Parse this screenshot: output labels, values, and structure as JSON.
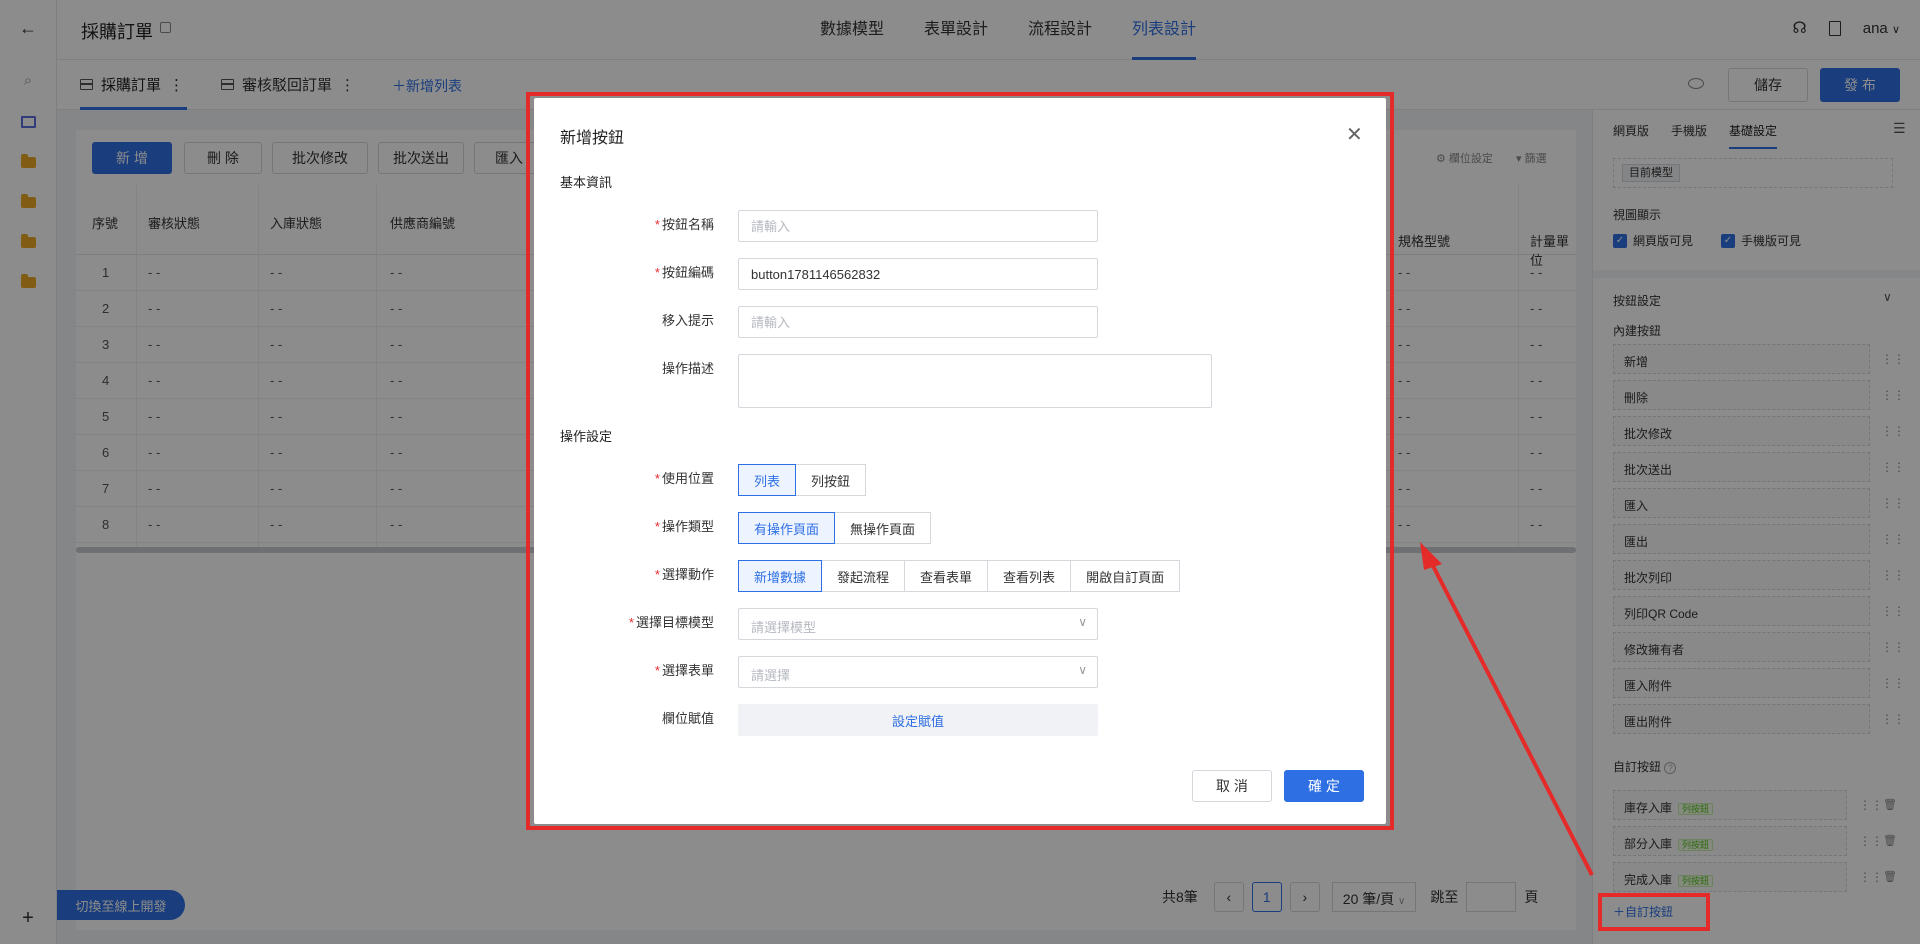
{
  "header": {
    "app_title": "採購訂單",
    "nav_tabs": [
      "數據模型",
      "表單設計",
      "流程設計",
      "列表設計"
    ],
    "user": "ana"
  },
  "subheader": {
    "list_tabs": [
      "採購訂單",
      "審核駁回訂單"
    ],
    "add_list": "＋新增列表",
    "save": "儲存",
    "publish": "發 布"
  },
  "toolbar": {
    "buttons": [
      "新 增",
      "刪 除",
      "批次修改",
      "批次送出",
      "匯入"
    ],
    "column_settings": "欄位設定",
    "filter": "篩選"
  },
  "table": {
    "headers": [
      "序號",
      "審核狀態",
      "入庫狀態",
      "供應商編號",
      "規格型號",
      "計量單位"
    ],
    "rows": [
      [
        "1",
        "- -",
        "- -",
        "- -",
        "- -",
        "- -"
      ],
      [
        "2",
        "- -",
        "- -",
        "- -",
        "- -",
        "- -"
      ],
      [
        "3",
        "- -",
        "- -",
        "- -",
        "- -",
        "- -"
      ],
      [
        "4",
        "- -",
        "- -",
        "- -",
        "- -",
        "- -"
      ],
      [
        "5",
        "- -",
        "- -",
        "- -",
        "- -",
        "- -"
      ],
      [
        "6",
        "- -",
        "- -",
        "- -",
        "- -",
        "- -"
      ],
      [
        "7",
        "- -",
        "- -",
        "- -",
        "- -",
        "- -"
      ],
      [
        "8",
        "- -",
        "- -",
        "- -",
        "- -",
        "- -"
      ]
    ]
  },
  "pagination": {
    "total": "共8筆",
    "current_page": "1",
    "page_size": "20 筆/頁",
    "jump_label": "跳至",
    "page_label": "頁"
  },
  "switch_online": "切換至線上開發",
  "right_panel": {
    "tabs": [
      "網頁版",
      "手機版",
      "基礎設定"
    ],
    "current_model": "目前模型",
    "view_label": "視圖顯示",
    "web_visible": "網頁版可見",
    "mobile_visible": "手機版可見",
    "button_settings": "按鈕設定",
    "builtin_label": "內建按鈕",
    "builtin_buttons": [
      "新增",
      "刪除",
      "批次修改",
      "批次送出",
      "匯入",
      "匯出",
      "批次列印",
      "列印QR Code",
      "修改擁有者",
      "匯入附件",
      "匯出附件"
    ],
    "custom_label": "自訂按鈕",
    "custom_buttons": [
      "庫存入庫",
      "部分入庫",
      "完成入庫"
    ],
    "custom_tag": "列按鈕",
    "add_custom": "＋自訂按鈕"
  },
  "modal": {
    "title": "新增按鈕",
    "section_basic": "基本資訊",
    "name_label": "按鈕名稱",
    "name_placeholder": "請輸入",
    "code_label": "按鈕編碼",
    "code_value": "button1781146562832",
    "hint_label": "移入提示",
    "hint_placeholder": "請輸入",
    "desc_label": "操作描述",
    "section_op": "操作設定",
    "position_label": "使用位置",
    "position_options": [
      "列表",
      "列按鈕"
    ],
    "type_label": "操作類型",
    "type_options": [
      "有操作頁面",
      "無操作頁面"
    ],
    "action_label": "選擇動作",
    "action_options": [
      "新增數據",
      "發起流程",
      "查看表單",
      "查看列表",
      "開啟自訂頁面"
    ],
    "target_label": "選擇目標模型",
    "target_placeholder": "請選擇模型",
    "form_label": "選擇表單",
    "form_placeholder": "請選擇",
    "assign_label": "欄位賦值",
    "assign_button": "設定賦值",
    "cancel": "取 消",
    "confirm": "確 定"
  }
}
